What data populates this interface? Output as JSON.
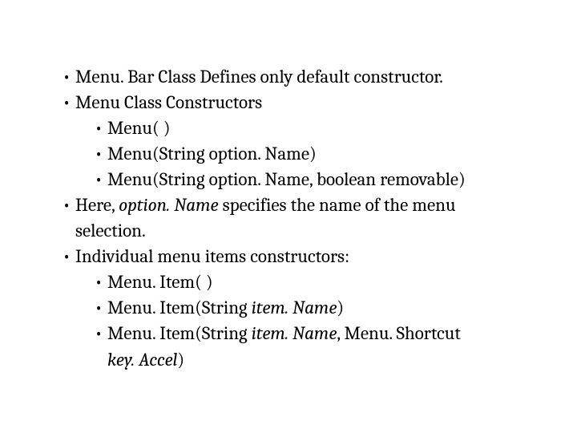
{
  "b1": "Menu. Bar Class Defines only default constructor.",
  "b2": "Menu Class Constructors",
  "b2a": "Menu( )",
  "b2b": "Menu(String option. Name)",
  "b2c": "Menu(String option. Name, boolean removable)",
  "b3_pre": "Here, ",
  "b3_it": "option. Name",
  "b3_post": " specifies the name of the menu",
  "b3_cont": "selection.",
  "b4": "Individual menu items constructors:",
  "b4a": "Menu. Item( )",
  "b4b_pre": "Menu. Item(String ",
  "b4b_it": "item. Name",
  "b4b_post": ")",
  "b4c_pre": "Menu. Item(String ",
  "b4c_it": "item. Name",
  "b4c_mid": ", Menu. Shortcut",
  "b4c_cont_it": "key. Accel",
  "b4c_cont_post": ")"
}
